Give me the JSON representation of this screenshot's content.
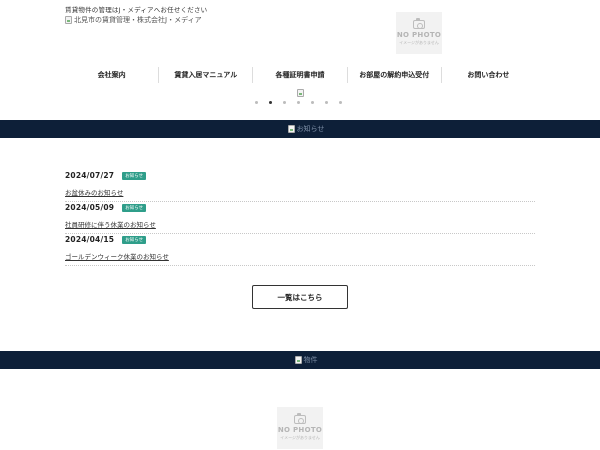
{
  "header": {
    "tagline": "賃貸物件の管理はJ・メディアへお任せください",
    "logo_alt": "北見市の賃貸管理・株式会社J・メディア"
  },
  "no_photo": {
    "title": "NO PHOTO",
    "subtitle": "イメージがありません"
  },
  "nav": {
    "items": [
      {
        "label": "会社案内"
      },
      {
        "label": "賃貸入居マニュアル"
      },
      {
        "label": "各種証明書申請"
      },
      {
        "label": "お部屋の解約申込受付"
      },
      {
        "label": "お問い合わせ"
      }
    ]
  },
  "slider": {
    "dot_count": 7,
    "active_dot": 1
  },
  "news_banner": {
    "alt": "お知らせ"
  },
  "news": {
    "items": [
      {
        "date": "2024/07/27",
        "badge": "お知らせ",
        "title": "お盆休みのお知らせ"
      },
      {
        "date": "2024/05/09",
        "badge": "お知らせ",
        "title": "社員研修に伴う休業のお知らせ"
      },
      {
        "date": "2024/04/15",
        "badge": "お知らせ",
        "title": "ゴールデンウィーク休業のお知らせ"
      }
    ],
    "more_label": "一覧はこちら"
  },
  "second_banner": {
    "alt": "物件"
  },
  "colors": {
    "band": "#0d1f38",
    "badge": "#2f9e8a"
  }
}
